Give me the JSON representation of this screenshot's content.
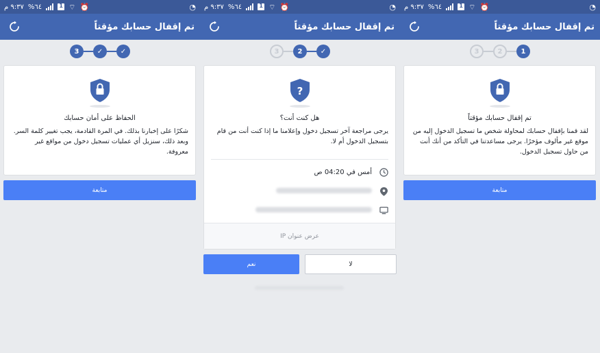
{
  "statusbar": {
    "time": "٩:٣٧ م",
    "battery": "%٦٤",
    "sim1": "1",
    "sim2": "1"
  },
  "app": {
    "title": "تم إقفال حسابك مؤقتاً"
  },
  "screen1": {
    "steps": [
      "1",
      "2",
      "3"
    ],
    "heading": "تم إقفال حسابك مؤقتاً",
    "body": "لقد قمنا بإقفال حسابك لمحاولة شخص ما تسجيل الدخول إليه من موقع غير مألوف مؤخرًا. يرجى مساعدتنا في التأكد من أنك أنت من حاول تسجيل الدخول.",
    "continue_label": "متابعة"
  },
  "screen2": {
    "steps": [
      "3",
      "2"
    ],
    "heading": "هل كنت أنت؟",
    "body": "يرجى مراجعة آخر تسجيل دخول وإعلامنا ما إذا كنت أنت من قام بتسجيل الدخول أم لا.",
    "login_time": "أمس في 04:20 ص",
    "show_ip_label": "عرض عنوان IP",
    "yes_label": "نعم",
    "no_label": "لا"
  },
  "screen3": {
    "steps": [
      "3"
    ],
    "heading": "الحفاظ على أمان حسابك",
    "body": "شكرًا على إخبارنا بذلك. في المرة القادمة، يجب تغيير كلمة السر. وبعد ذلك، سنزيل أي عمليات تسجيل دخول من مواقع غير معروفة.",
    "continue_label": "متابعة"
  },
  "colors": {
    "header": "#4267b2",
    "statusbar": "#3b5998",
    "button": "#4a7ff6",
    "background": "#e9ebee"
  }
}
